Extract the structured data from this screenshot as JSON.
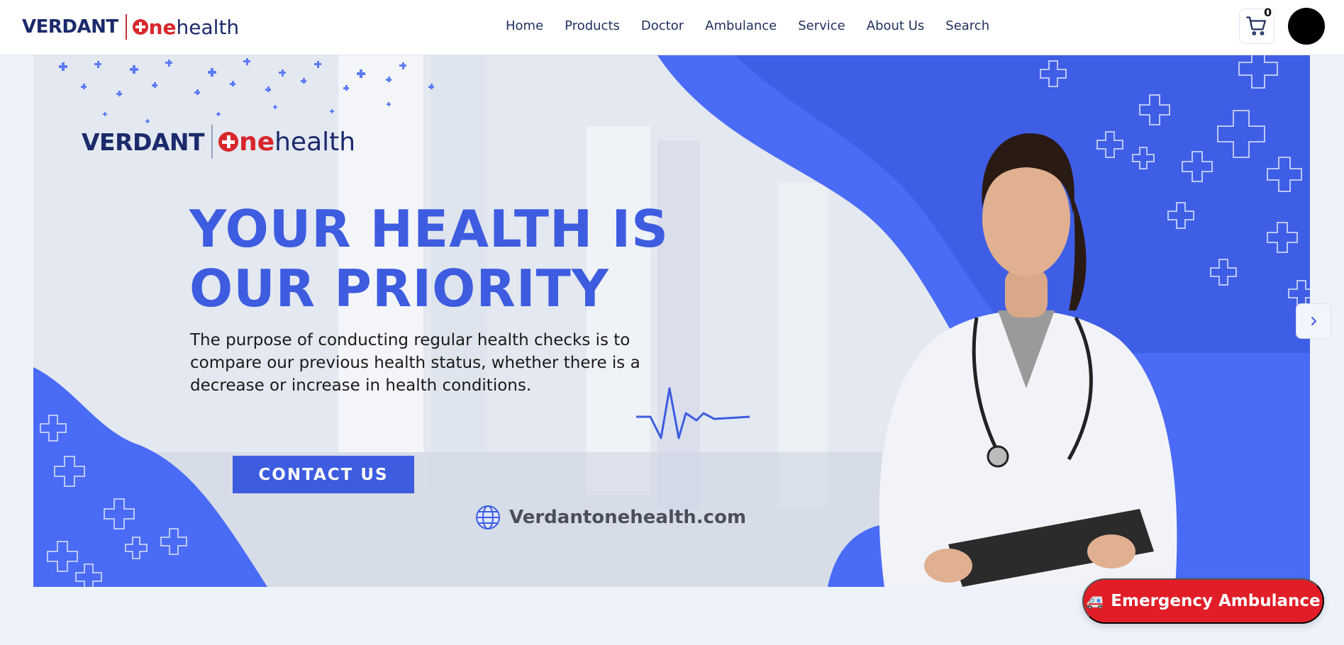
{
  "header": {
    "logo": {
      "verdant": "VERDANT",
      "one": "ne",
      "health": "health"
    },
    "nav": [
      "Home",
      "Products",
      "Doctor",
      "Ambulance",
      "Service",
      "About Us",
      "Search"
    ],
    "cart_count": "0"
  },
  "banner": {
    "logo": {
      "verdant": "VERDANT",
      "one": "ne",
      "health": "health"
    },
    "headline_line1": "YOUR HEALTH IS",
    "headline_line2": "OUR PRIORITY",
    "subtext": "The purpose of conducting regular health checks is to compare our previous health status, whether there is a decrease or increase in health conditions.",
    "cta": "CONTACT US",
    "website": "Verdantonehealth.com"
  },
  "emergency": {
    "label": "Emergency Ambulance",
    "icon": "ambulance-icon"
  },
  "colors": {
    "brand_blue": "#3d5ce0",
    "brand_red": "#e11d27",
    "navy": "#1b2a6b"
  }
}
